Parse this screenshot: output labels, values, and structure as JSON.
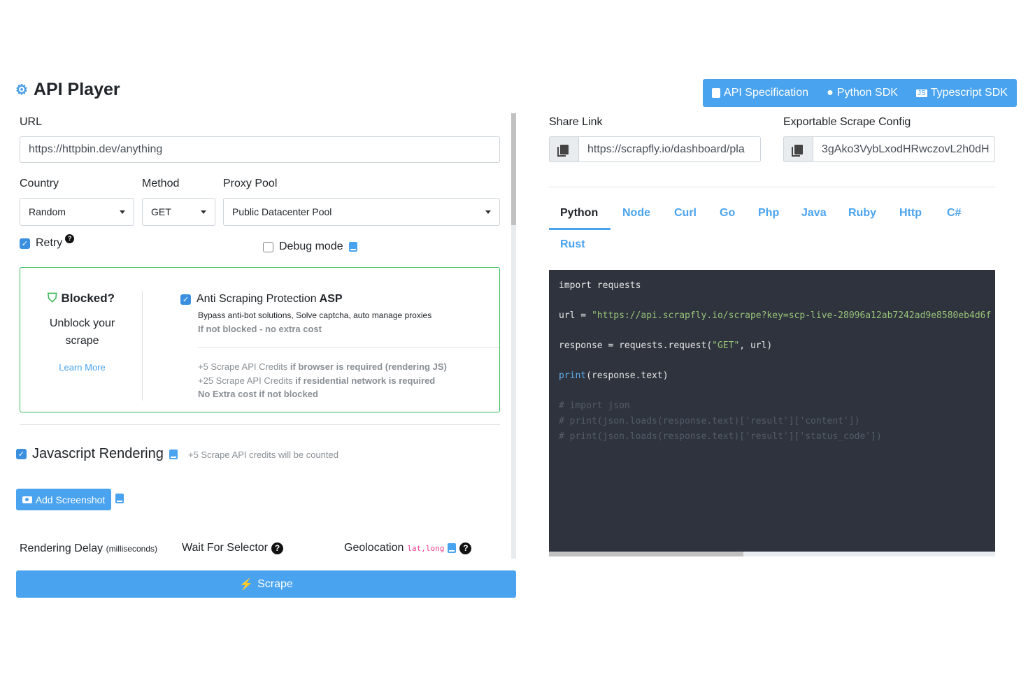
{
  "header": {
    "title": "API Player",
    "buttons": [
      {
        "label": "API Specification",
        "icon": "book-icon"
      },
      {
        "label": "Python SDK",
        "icon": "python-icon"
      },
      {
        "label": "Typescript SDK",
        "icon": "js-icon"
      }
    ]
  },
  "form": {
    "url_label": "URL",
    "url_value": "https://httpbin.dev/anything",
    "country_label": "Country",
    "country_value": "Random",
    "method_label": "Method",
    "method_value": "GET",
    "proxy_label": "Proxy Pool",
    "proxy_value": "Public Datacenter Pool",
    "retry_label": "Retry",
    "retry_checked": true,
    "debug_label": "Debug mode",
    "debug_checked": false
  },
  "asp": {
    "blocked_title": "Blocked?",
    "blocked_line1": "Unblock your",
    "blocked_line2": "scrape",
    "learn_more": "Learn More",
    "checkbox_label": "Anti Scraping Protection",
    "checkbox_label_bold": "ASP",
    "checked": true,
    "desc": "Bypass anti-bot solutions, Solve captcha, auto manage proxies",
    "note": "If not blocked - no extra cost",
    "cost1_plain": "+5 Scrape API Credits",
    "cost1_bold": "if browser is required (rendering JS)",
    "cost2_plain": "+25 Scrape API Credits",
    "cost2_bold": "if residential network is required",
    "cost3": "No Extra cost if not blocked"
  },
  "js": {
    "label": "Javascript Rendering",
    "checked": true,
    "note": "+5 Scrape API credits will be counted",
    "screenshot_button": "Add Screenshot",
    "delay_label": "Rendering Delay",
    "delay_unit": "(milliseconds)",
    "wait_label": "Wait For Selector",
    "geo_label": "Geolocation",
    "geo_hint": "lat,long"
  },
  "scrape_button": "Scrape",
  "share": {
    "share_label": "Share Link",
    "share_value": "https://scrapfly.io/dashboard/pla",
    "export_label": "Exportable Scrape Config",
    "export_value": "3gAko3VybLxodHRwczovL2h0dH"
  },
  "tabs": [
    "Python",
    "Node",
    "Curl",
    "Go",
    "Php",
    "Java",
    "Ruby",
    "Http",
    "C#",
    "Rust"
  ],
  "active_tab": "Python",
  "code": {
    "l1": "import requests",
    "l2a": "url = ",
    "l2b": "\"https://api.scrapfly.io/scrape?key=scp-live-28096a12ab7242ad9e8580eb4d6f",
    "l3a": "response = requests.request(",
    "l3b": "\"GET\"",
    "l3c": ", url)",
    "l4a": "print",
    "l4b": "(response.text)",
    "c1": "# import json",
    "c2": "# print(json.loads(response.text)['result']['content'])",
    "c3": "# print(json.loads(response.text)['result']['status_code'])"
  }
}
